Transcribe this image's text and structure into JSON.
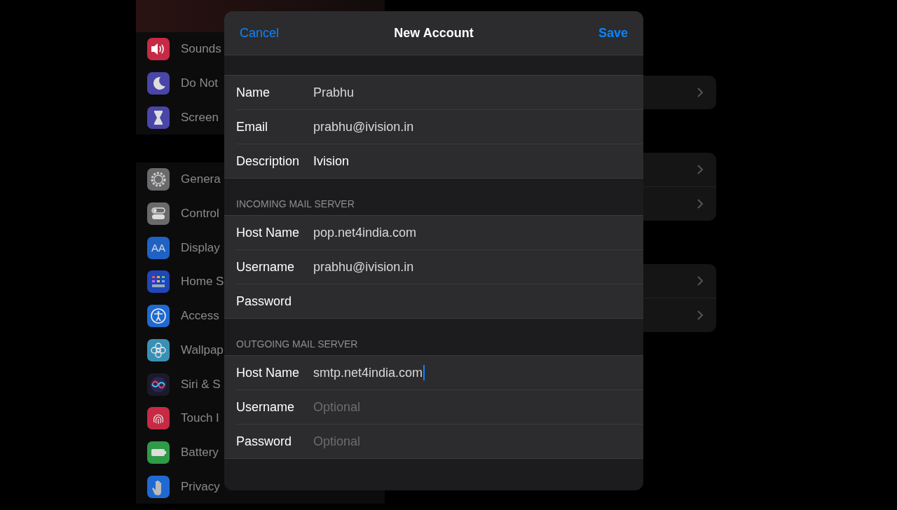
{
  "sidebar": {
    "groups": [
      {
        "items": [
          {
            "label": "Sounds",
            "color": "#c62a44"
          },
          {
            "label": "Do Not",
            "color": "#4a45a8"
          },
          {
            "label": "Screen",
            "color": "#4a45a8"
          }
        ]
      },
      {
        "items": [
          {
            "label": "Genera",
            "color": "#6a6a6c"
          },
          {
            "label": "Control",
            "color": "#6a6a6c"
          },
          {
            "label": "Display",
            "color": "#1f62c4",
            "glyph": "AA"
          },
          {
            "label": "Home S",
            "color": "#2146b8"
          },
          {
            "label": "Access",
            "color": "#1f6ad2"
          },
          {
            "label": "Wallpap",
            "color": "#3a90b4"
          },
          {
            "label": "Siri & S",
            "color": "#1a1a2a"
          },
          {
            "label": "Touch I",
            "color": "#c62a44"
          },
          {
            "label": "Battery",
            "color": "#2f9a48"
          },
          {
            "label": "Privacy",
            "color": "#1f6ad2"
          }
        ]
      }
    ]
  },
  "sheet": {
    "cancel": "Cancel",
    "title": "New Account",
    "save": "Save",
    "sections": [
      {
        "rows": [
          {
            "label": "Name",
            "value": "Prabhu"
          },
          {
            "label": "Email",
            "value": "prabhu@ivision.in"
          },
          {
            "label": "Description",
            "value": "Ivision"
          }
        ]
      },
      {
        "header": "INCOMING MAIL SERVER",
        "rows": [
          {
            "label": "Host Name",
            "value": "pop.net4india.com"
          },
          {
            "label": "Username",
            "value": "prabhu@ivision.in"
          },
          {
            "label": "Password"
          }
        ]
      },
      {
        "header": "OUTGOING MAIL SERVER",
        "rows": [
          {
            "label": "Host Name",
            "value": "smtp.net4india.com",
            "focused": true
          },
          {
            "label": "Username",
            "placeholder": "Optional"
          },
          {
            "label": "Password",
            "placeholder": "Optional"
          }
        ]
      }
    ]
  }
}
